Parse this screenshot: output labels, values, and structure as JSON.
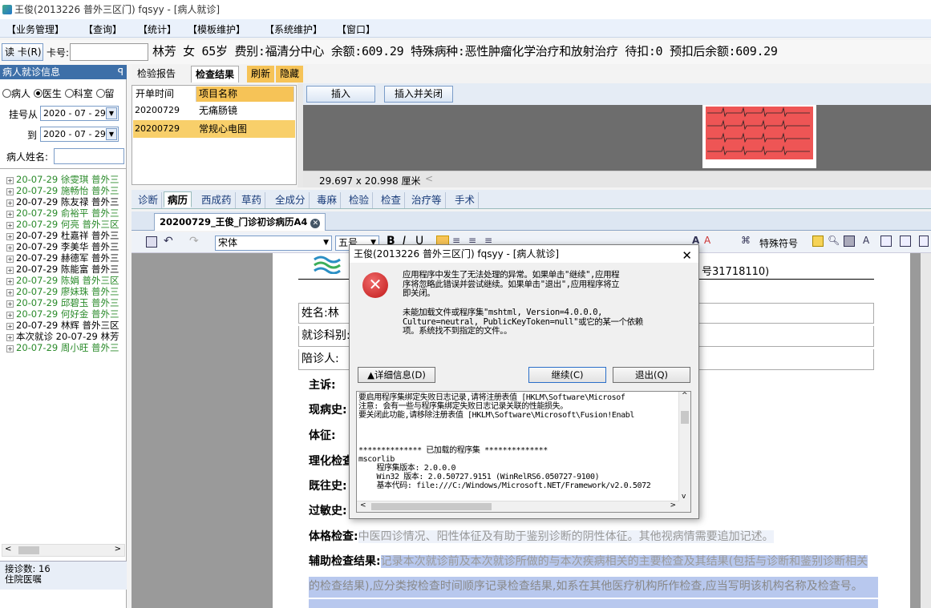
{
  "window": {
    "title": "王俊(2013226 普外三区门) fqsyy - [病人就诊]"
  },
  "menu": [
    "【业务管理】",
    "【查询】",
    "【统计】",
    "【模板维护】",
    "【系统维护】",
    "【窗口】"
  ],
  "patientbar": {
    "read_card": "读 卡(R)",
    "card_label": "卡号:",
    "card_value": "",
    "info": "林芳 女 65岁 费别:福清分中心 余额:609.29 特殊病种:恶性肿瘤化学治疗和放射治疗 待扣:0 预扣后余额:609.29"
  },
  "left": {
    "header": "病人就诊信息",
    "pin": "ꟼ",
    "radios": [
      "病人",
      "医生",
      "科室",
      "留"
    ],
    "date_from_label": "挂号从",
    "date_to_label": "到",
    "date_from": "2020 - 07 - 29",
    "date_to": "2020 - 07 - 29",
    "name_label": "病人姓名:",
    "name_value": "",
    "tree": [
      {
        "text": "20-07-29 徐雯琪 普外三",
        "color": "green"
      },
      {
        "text": "20-07-29 施畅怡 普外三",
        "color": "green"
      },
      {
        "text": "20-07-29 陈友禄 普外三",
        "color": "black"
      },
      {
        "text": "20-07-29 俞裕平 普外三",
        "color": "green"
      },
      {
        "text": "20-07-29 何亮 普外三区",
        "color": "green"
      },
      {
        "text": "20-07-29 杜嘉祥 普外三",
        "color": "black"
      },
      {
        "text": "20-07-29 李美华 普外三",
        "color": "black"
      },
      {
        "text": "20-07-29 赫德军 普外三",
        "color": "black"
      },
      {
        "text": "20-07-29 陈能富 普外三",
        "color": "black"
      },
      {
        "text": "20-07-29 陈娟 普外三区",
        "color": "green"
      },
      {
        "text": "20-07-29 廖妹珠 普外三",
        "color": "green"
      },
      {
        "text": "20-07-29 邱碧玉 普外三",
        "color": "green"
      },
      {
        "text": "20-07-29 何好金 普外三",
        "color": "green"
      },
      {
        "text": "20-07-29 林辉 普外三区",
        "color": "black"
      },
      {
        "text": "本次就诊 20-07-29 林芳",
        "color": "black"
      },
      {
        "text": "20-07-29 周小旺 普外三",
        "color": "green"
      }
    ],
    "status1": "接诊数: 16",
    "status2": "住院医嘱"
  },
  "toptabs": [
    "检验报告",
    "检查结果",
    "刷新",
    "隐藏"
  ],
  "grid": {
    "headers": [
      "开单时间",
      "项目名称"
    ],
    "rows": [
      {
        "time": "20200729",
        "name": "无痛肠镜"
      },
      {
        "time": "20200729",
        "name": "常规心电图"
      }
    ]
  },
  "buttons": {
    "insert": "插入",
    "insert_close": "插入并关闭"
  },
  "preview": {
    "size": "29.697 x 20.998 厘米"
  },
  "tabs2": [
    "诊断",
    "病历",
    "西成药",
    "草药",
    "全成分",
    "毒麻",
    "检验",
    "检查",
    "治疗等",
    "手术"
  ],
  "doc_tab": "20200729_王俊_门诊初诊病历A4",
  "editor": {
    "font": "宋体",
    "size": "五号",
    "special": "特殊符号"
  },
  "document": {
    "header_right": "号31718110)",
    "name_label": "姓名:",
    "name_value": "林",
    "dept_label": "就诊科别:",
    "companion_label": "陪诊人:",
    "sections": [
      "主诉:",
      "现病史:",
      "体征:",
      "理化检查",
      "既往史:",
      "过敏史:"
    ],
    "exam_label": "体格检查:",
    "exam_hint": "中医四诊情况、阳性体征及有助于鉴别诊断的阴性体征。其他视病情需要追加记述。",
    "aux_label": "辅助检查结果:",
    "aux_text_1": "记录本次就诊前及本次就诊所做的与本次疾病相关的主要检查及其结果(包括与诊断和鉴别诊断相关",
    "aux_text_2": "的检查结果),应分类按检查时间顺序记录检查结果,如系在其他医疗机构所作检查,应当写明该机构名称及检查号。"
  },
  "dialog": {
    "title": "王俊(2013226 普外三区门) fqsyy - [病人就诊]",
    "message1": "应用程序中发生了无法处理的异常。如果单击\"继续\",应用程\n序将忽略此错误并尝试继续。如果单击\"退出\",应用程序将立\n即关闭。",
    "message2": "未能加载文件或程序集\"mshtml, Version=4.0.0.0,\nCulture=neutral, PublicKeyToken=null\"或它的某一个依赖\n项。系统找不到指定的文件。。",
    "details_button": "▲详细信息(D)",
    "continue_button": "继续(C)",
    "exit_button": "退出(Q)",
    "details": "要启用程序集绑定失败日志记录,请将注册表值 [HKLM\\Software\\Microsof\n注意: 会有一些与程序集绑定失败日志记录关联的性能损失。\n要关闭此功能,请移除注册表值 [HKLM\\Software\\Microsoft\\Fusion!Enabl\n\n\n\n************** 已加载的程序集 **************\nmscorlib\n    程序集版本: 2.0.0.0\n    Win32 版本: 2.0.50727.9151 (WinRelRS6.050727-9100)\n    基本代码: file:///C:/Windows/Microsoft.NET/Framework/v2.0.5072"
  }
}
